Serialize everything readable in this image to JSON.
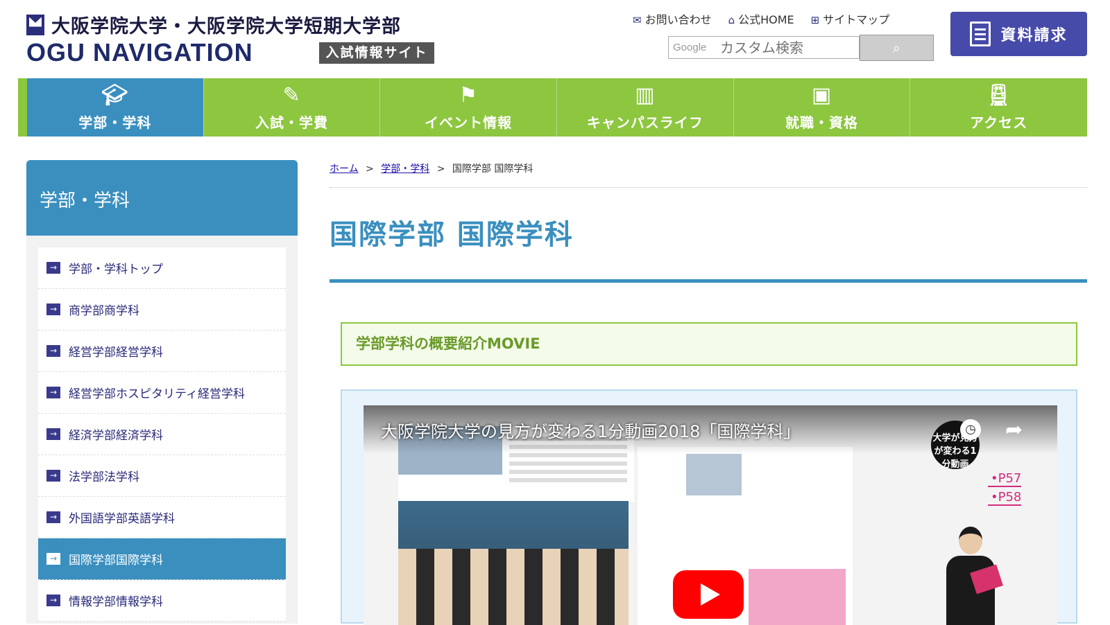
{
  "header": {
    "university": "大阪学院大学・大阪学院大学短期大学部",
    "site_name": "OGU NAVIGATION",
    "badge": "入試情報サイト",
    "util_links": [
      {
        "label": "お問い合わせ",
        "icon": "mail-icon"
      },
      {
        "label": "公式HOME",
        "icon": "home-icon"
      },
      {
        "label": "サイトマップ",
        "icon": "sitemap-icon"
      }
    ],
    "search_placeholder": "カスタム検索",
    "search_brand": "Google",
    "request_label": "資料請求"
  },
  "globalnav": [
    {
      "label": "学部・学科",
      "icon": "mortarboard-icon",
      "active": true
    },
    {
      "label": "入試・学費",
      "icon": "pen-paper-icon",
      "active": false
    },
    {
      "label": "イベント情報",
      "icon": "flag-icon",
      "active": false
    },
    {
      "label": "キャンパスライフ",
      "icon": "campus-icon",
      "active": false
    },
    {
      "label": "就職・資格",
      "icon": "briefcase-icon",
      "active": false
    },
    {
      "label": "アクセス",
      "icon": "train-icon",
      "active": false
    }
  ],
  "sidebar": {
    "title": "学部・学科",
    "items": [
      {
        "label": "学部・学科トップ",
        "active": false
      },
      {
        "label": "商学部商学科",
        "active": false
      },
      {
        "label": "経営学部経営学科",
        "active": false
      },
      {
        "label": "経営学部ホスピタリティ経営学科",
        "active": false
      },
      {
        "label": "経済学部経済学科",
        "active": false
      },
      {
        "label": "法学部法学科",
        "active": false
      },
      {
        "label": "外国語学部英語学科",
        "active": false
      },
      {
        "label": "国際学部国際学科",
        "active": true
      },
      {
        "label": "情報学部情報学科",
        "active": false
      }
    ]
  },
  "breadcrumb": {
    "home": "ホーム",
    "sep": ">",
    "parent": "学部・学科",
    "current": "国際学部 国際学科"
  },
  "main": {
    "title": "国際学部 国際学科",
    "section_heading": "学部学科の概要紹介MOVIE",
    "video": {
      "title": "大阪学院大学の見方が変わる1分動画2018「国際学科」",
      "badge": "大学が見方が変わる1分動画",
      "tags": [
        "P57",
        "P58"
      ]
    }
  },
  "colors": {
    "nav_green": "#8dc63f",
    "accent_blue": "#3a8fbf",
    "brand_navy": "#464aa8"
  }
}
